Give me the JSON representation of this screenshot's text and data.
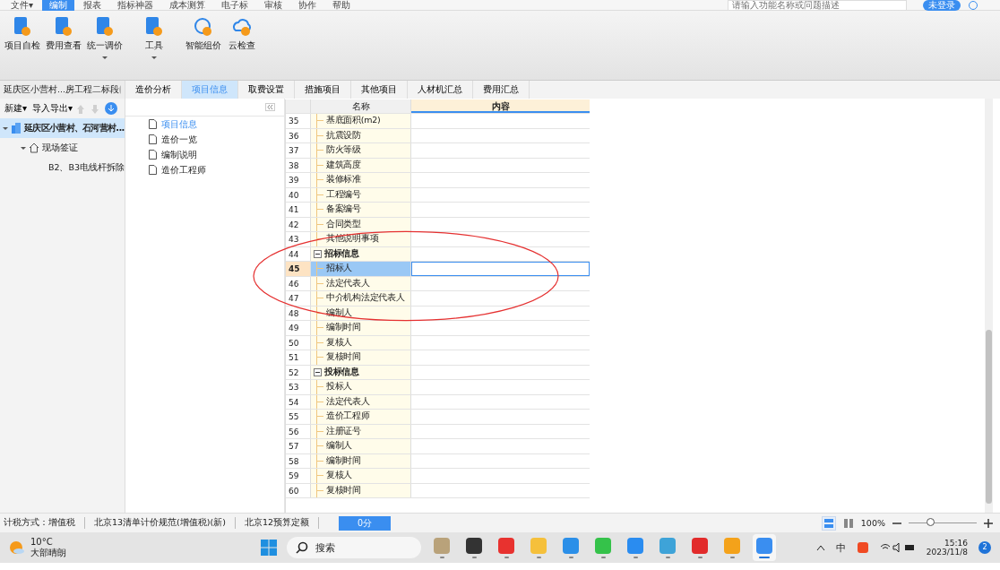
{
  "menu": [
    {
      "label": "文件▾",
      "selected": false
    },
    {
      "label": "编制",
      "selected": true
    },
    {
      "label": "报表",
      "selected": false
    },
    {
      "label": "指标神器",
      "selected": false
    },
    {
      "label": "成本测算",
      "selected": false
    },
    {
      "label": "电子标",
      "selected": false
    },
    {
      "label": "审核",
      "selected": false
    },
    {
      "label": "协作",
      "selected": false
    },
    {
      "label": "帮助",
      "selected": false
    }
  ],
  "search": {
    "placeholder": "请输入功能名称或问题描述"
  },
  "login_button": "未登录",
  "toolbar": [
    {
      "label": "项目自检",
      "kind": "check",
      "dropdown": false
    },
    {
      "label": "费用查看",
      "kind": "fee",
      "dropdown": false
    },
    {
      "label": "统一调价",
      "kind": "price",
      "dropdown": true
    },
    {
      "label": "工具",
      "kind": "tool",
      "dropdown": true
    },
    {
      "label": "智能组价",
      "kind": "smart",
      "dropdown": false
    },
    {
      "label": "云检查",
      "kind": "cloud",
      "dropdown": false
    }
  ],
  "project_title": "延庆区小营村...房工程二标段",
  "tabs": [
    {
      "label": "造价分析",
      "selected": false
    },
    {
      "label": "项目信息",
      "selected": true
    },
    {
      "label": "取费设置",
      "selected": false
    },
    {
      "label": "措施项目",
      "selected": false
    },
    {
      "label": "其他项目",
      "selected": false
    },
    {
      "label": "人材机汇总",
      "selected": false
    },
    {
      "label": "费用汇总",
      "selected": false
    }
  ],
  "left_toolbar": [
    "新建▾",
    "导入导出▾"
  ],
  "tree": [
    {
      "label": "延庆区小营村、石河营村...",
      "kind": "building",
      "selected": true,
      "expanded": true,
      "children": [
        {
          "label": "现场签证",
          "kind": "house",
          "selected": false,
          "expanded": true,
          "children": [
            {
              "label": "B2、B3电线杆拆除",
              "kind": "leaf",
              "selected": false
            }
          ]
        }
      ]
    }
  ],
  "nav": [
    {
      "label": "项目信息",
      "selected": true
    },
    {
      "label": "造价一览",
      "selected": false
    },
    {
      "label": "编制说明",
      "selected": false
    },
    {
      "label": "造价工程师",
      "selected": false
    }
  ],
  "table": {
    "columns": [
      "名称",
      "内容"
    ],
    "rows": [
      {
        "no": "35",
        "name": "基底面积(m2)",
        "kind": "item",
        "selected": false
      },
      {
        "no": "36",
        "name": "抗震设防",
        "kind": "item",
        "selected": false
      },
      {
        "no": "37",
        "name": "防火等级",
        "kind": "item",
        "selected": false
      },
      {
        "no": "38",
        "name": "建筑高度",
        "kind": "item",
        "selected": false
      },
      {
        "no": "39",
        "name": "装修标准",
        "kind": "item",
        "selected": false
      },
      {
        "no": "40",
        "name": "工程编号",
        "kind": "item",
        "selected": false
      },
      {
        "no": "41",
        "name": "备案编号",
        "kind": "item",
        "selected": false
      },
      {
        "no": "42",
        "name": "合同类型",
        "kind": "item",
        "selected": false
      },
      {
        "no": "43",
        "name": "其他说明事项",
        "kind": "item",
        "selected": false
      },
      {
        "no": "44",
        "name": "招标信息",
        "kind": "group",
        "selected": false
      },
      {
        "no": "45",
        "name": "招标人",
        "kind": "item",
        "selected": true
      },
      {
        "no": "46",
        "name": "法定代表人",
        "kind": "item",
        "selected": false
      },
      {
        "no": "47",
        "name": "中介机构法定代表人",
        "kind": "item",
        "selected": false
      },
      {
        "no": "48",
        "name": "编制人",
        "kind": "item",
        "selected": false
      },
      {
        "no": "49",
        "name": "编制时间",
        "kind": "item",
        "selected": false
      },
      {
        "no": "50",
        "name": "复核人",
        "kind": "item",
        "selected": false
      },
      {
        "no": "51",
        "name": "复核时间",
        "kind": "item",
        "selected": false
      },
      {
        "no": "52",
        "name": "投标信息",
        "kind": "group",
        "selected": false
      },
      {
        "no": "53",
        "name": "投标人",
        "kind": "item",
        "selected": false
      },
      {
        "no": "54",
        "name": "法定代表人",
        "kind": "item",
        "selected": false
      },
      {
        "no": "55",
        "name": "造价工程师",
        "kind": "item",
        "selected": false
      },
      {
        "no": "56",
        "name": "注册证号",
        "kind": "item",
        "selected": false
      },
      {
        "no": "57",
        "name": "编制人",
        "kind": "item",
        "selected": false
      },
      {
        "no": "58",
        "name": "编制时间",
        "kind": "item",
        "selected": false
      },
      {
        "no": "59",
        "name": "复核人",
        "kind": "item",
        "selected": false
      },
      {
        "no": "60",
        "name": "复核时间",
        "kind": "item",
        "selected": false
      }
    ]
  },
  "status_bar": {
    "items": [
      "计税方式：增值税",
      "北京13清单计价规范(增值税)(新)",
      "北京12预算定额"
    ],
    "score_button": "0分",
    "zoom": "100%",
    "zoom_slider": {
      "level": 0.33
    }
  },
  "taskbar": {
    "weather": {
      "temp": "10°C",
      "desc": "大部晴朗"
    },
    "search": "搜索",
    "apps": [
      {
        "kind": "book",
        "active": false
      },
      {
        "kind": "window",
        "active": false
      },
      {
        "kind": "wps",
        "active": false
      },
      {
        "kind": "folder",
        "active": false
      },
      {
        "kind": "browser",
        "active": false
      },
      {
        "kind": "chat",
        "active": false
      },
      {
        "kind": "edu",
        "active": false
      },
      {
        "kind": "archive",
        "active": false
      },
      {
        "kind": "pdf",
        "active": false
      },
      {
        "kind": "cloud",
        "active": false
      },
      {
        "kind": "app",
        "active": true
      }
    ],
    "ime": "中",
    "time": "15:16",
    "date": "2023/11/8",
    "notifications": "2"
  }
}
